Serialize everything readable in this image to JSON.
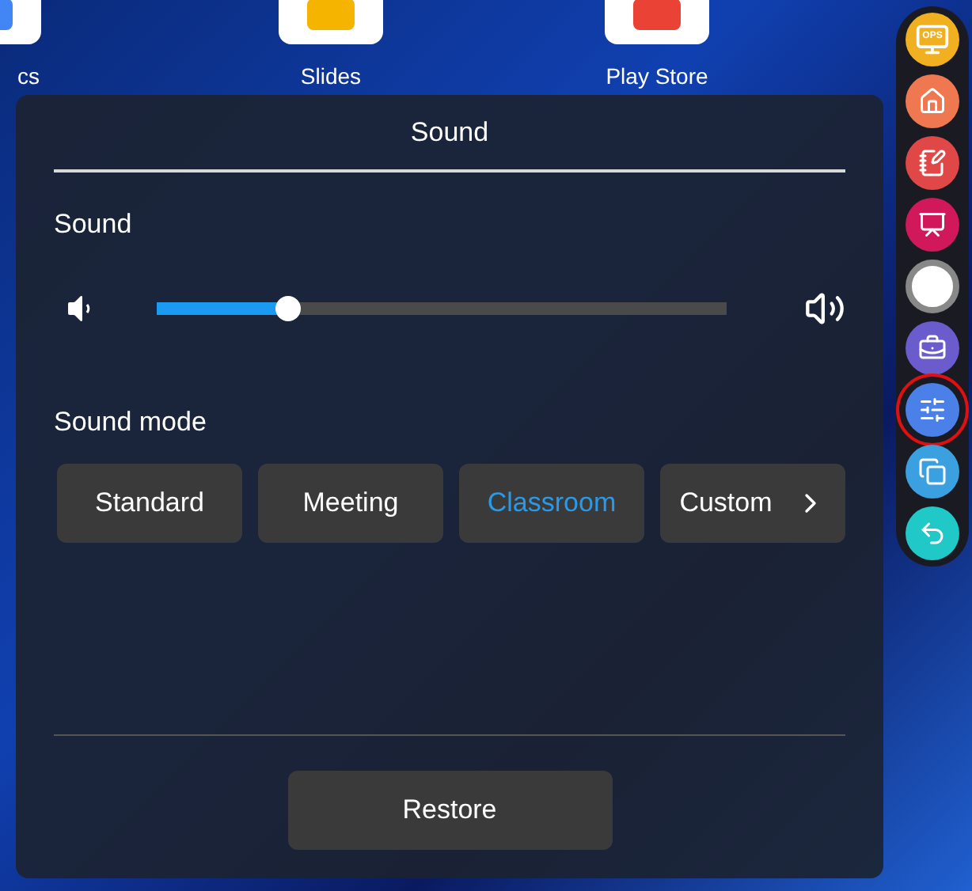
{
  "desktop": {
    "apps": [
      {
        "label": "cs",
        "color": "#4285f4"
      },
      {
        "label": "Slides",
        "color": "#f4b400"
      },
      {
        "label": "Play Store",
        "color": "#ea4335"
      }
    ]
  },
  "dialog": {
    "title": "Sound",
    "volume": {
      "label": "Sound",
      "level": 0.23
    },
    "sound_mode": {
      "label": "Sound mode",
      "options": [
        {
          "label": "Standard",
          "selected": false
        },
        {
          "label": "Meeting",
          "selected": false
        },
        {
          "label": "Classroom",
          "selected": true
        },
        {
          "label": "Custom",
          "selected": false
        }
      ]
    },
    "restore_button": "Restore"
  },
  "dock": [
    {
      "kind": "ops",
      "text": "OPS",
      "color": "#f0b020",
      "selected": false
    },
    {
      "kind": "home",
      "color": "#f07850",
      "selected": false
    },
    {
      "kind": "note",
      "color": "#e04848",
      "selected": false
    },
    {
      "kind": "board",
      "color": "#d0185a",
      "selected": false
    },
    {
      "kind": "record",
      "color": "#ffffff",
      "selected": false
    },
    {
      "kind": "toolbox",
      "color": "#6a5ccc",
      "selected": false
    },
    {
      "kind": "settings",
      "color": "#4a80e8",
      "selected": true
    },
    {
      "kind": "windows",
      "color": "#3aa0e0",
      "selected": false
    },
    {
      "kind": "back",
      "color": "#20c8c8",
      "selected": false
    }
  ]
}
